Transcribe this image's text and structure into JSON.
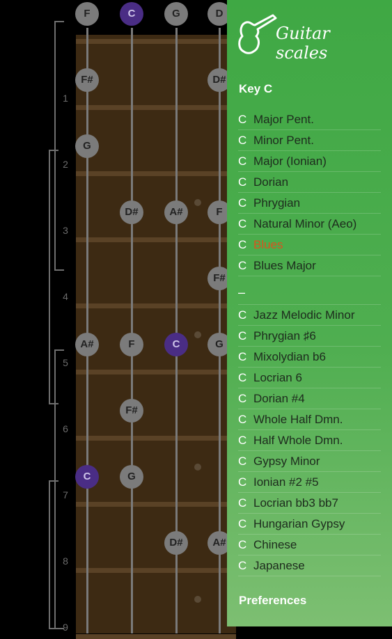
{
  "drawer": {
    "app_title": "Guitar scales",
    "key_label": "Key",
    "key_value": "C",
    "scales_a": [
      {
        "key": "C",
        "name": "Major Pent."
      },
      {
        "key": "C",
        "name": "Minor Pent."
      },
      {
        "key": "C",
        "name": "Major (Ionian)"
      },
      {
        "key": "C",
        "name": "Dorian"
      },
      {
        "key": "C",
        "name": "Phrygian"
      },
      {
        "key": "C",
        "name": "Natural Minor (Aeo)"
      },
      {
        "key": "C",
        "name": "Blues",
        "active": true
      },
      {
        "key": "C",
        "name": "Blues Major"
      }
    ],
    "separator": "–",
    "scales_b": [
      {
        "key": "C",
        "name": "Jazz Melodic Minor"
      },
      {
        "key": "C",
        "name": "Phrygian ♯6"
      },
      {
        "key": "C",
        "name": "Mixolydian b6"
      },
      {
        "key": "C",
        "name": "Locrian 6"
      },
      {
        "key": "C",
        "name": "Dorian #4"
      },
      {
        "key": "C",
        "name": "Whole Half Dmn."
      },
      {
        "key": "C",
        "name": "Half Whole Dmn."
      },
      {
        "key": "C",
        "name": "Gypsy Minor"
      },
      {
        "key": "C",
        "name": "Ionian #2 #5"
      },
      {
        "key": "C",
        "name": "Locrian bb3 bb7"
      },
      {
        "key": "C",
        "name": "Hungarian Gypsy"
      },
      {
        "key": "C",
        "name": "Chinese"
      },
      {
        "key": "C",
        "name": "Japanese"
      }
    ],
    "preferences_label": "Preferences",
    "active_color": "#d9531e"
  },
  "fretboard": {
    "open_notes": [
      "F",
      "C",
      "G",
      "D"
    ],
    "fret_numbers": [
      "1",
      "2",
      "3",
      "4",
      "5",
      "6",
      "7",
      "8",
      "9"
    ],
    "notes": [
      {
        "label": "F#",
        "string": 0,
        "fret": 1
      },
      {
        "label": "D#",
        "string": 3,
        "fret": 1
      },
      {
        "label": "G",
        "string": 0,
        "fret": 2
      },
      {
        "label": "D#",
        "string": 1,
        "fret": 3
      },
      {
        "label": "A#",
        "string": 2,
        "fret": 3
      },
      {
        "label": "F",
        "string": 3,
        "fret": 3
      },
      {
        "label": "F#",
        "string": 3,
        "fret": 4
      },
      {
        "label": "A#",
        "string": 0,
        "fret": 5
      },
      {
        "label": "F",
        "string": 1,
        "fret": 5
      },
      {
        "label": "C",
        "string": 2,
        "fret": 5,
        "root": true
      },
      {
        "label": "G",
        "string": 3,
        "fret": 5
      },
      {
        "label": "F#",
        "string": 1,
        "fret": 6
      },
      {
        "label": "C",
        "string": 0,
        "fret": 7,
        "root": true
      },
      {
        "label": "G",
        "string": 1,
        "fret": 7
      },
      {
        "label": "D#",
        "string": 2,
        "fret": 8
      },
      {
        "label": "A#",
        "string": 3,
        "fret": 8
      }
    ],
    "root_note": "C",
    "root_color": "#4a2d85"
  }
}
